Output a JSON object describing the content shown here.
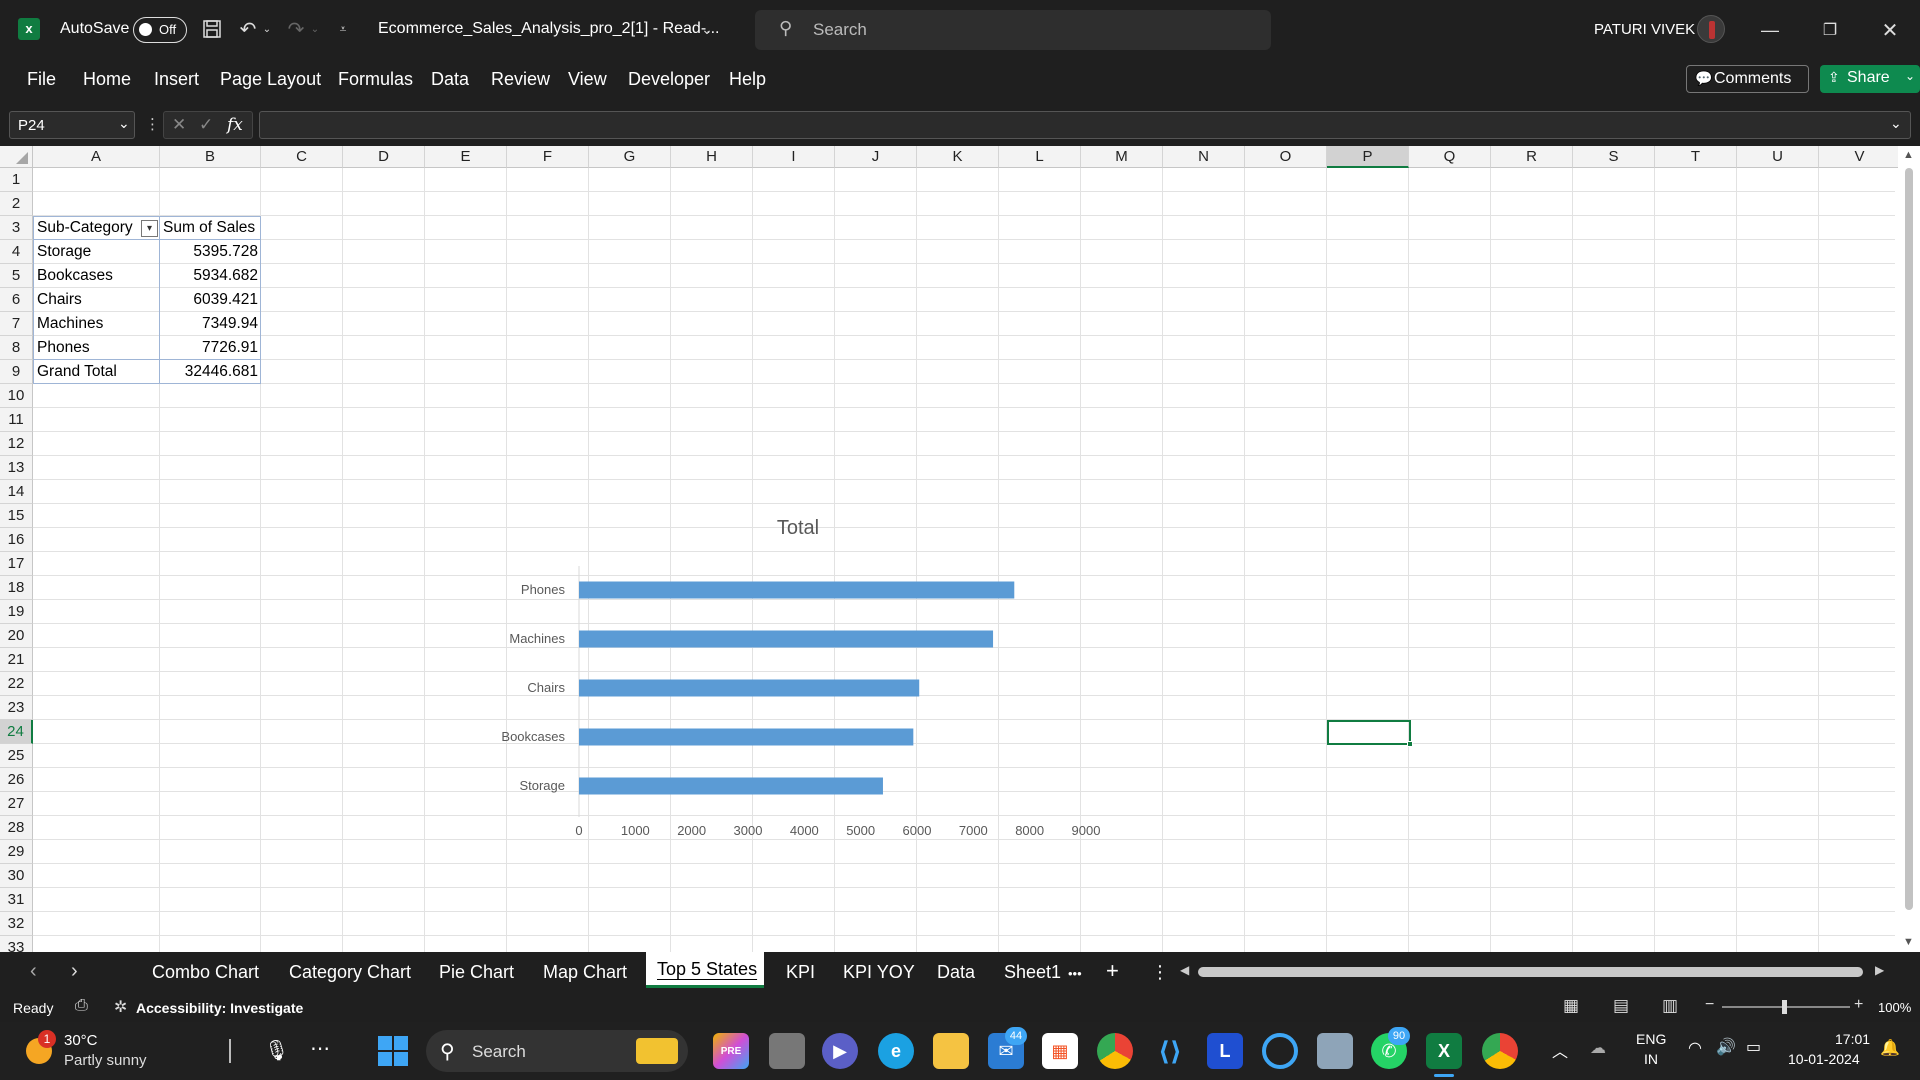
{
  "titlebar": {
    "autosave_label": "AutoSave",
    "autosave_state": "Off",
    "file_title": "Ecommerce_Sales_Analysis_pro_2[1]  -  Read-...",
    "search_placeholder": "Search",
    "user_name": "PATURI VIVEK"
  },
  "ribbon": {
    "tabs": [
      "File",
      "Home",
      "Insert",
      "Page Layout",
      "Formulas",
      "Data",
      "Review",
      "View",
      "Developer",
      "Help"
    ],
    "comments_label": "Comments",
    "share_label": "Share"
  },
  "formula_bar": {
    "name_box": "P24",
    "fx": "fx",
    "formula": ""
  },
  "grid": {
    "columns": [
      "A",
      "B",
      "C",
      "D",
      "E",
      "F",
      "G",
      "H",
      "I",
      "J",
      "K",
      "L",
      "M",
      "N",
      "O",
      "P",
      "Q",
      "R",
      "S",
      "T",
      "U",
      "V"
    ],
    "rows": [
      "1",
      "2",
      "3",
      "4",
      "5",
      "6",
      "7",
      "8",
      "9",
      "10",
      "11",
      "12",
      "13",
      "14",
      "15",
      "16",
      "17",
      "18",
      "19",
      "20",
      "21",
      "22",
      "23",
      "24",
      "25",
      "26",
      "27",
      "28",
      "29",
      "30",
      "31",
      "32",
      "33"
    ],
    "selected_cell": "P24"
  },
  "pivot": {
    "header_a": "Sub-Category",
    "header_b": "Sum of Sales",
    "rows": [
      {
        "label": "Storage",
        "value": "5395.728"
      },
      {
        "label": "Bookcases",
        "value": "5934.682"
      },
      {
        "label": "Chairs",
        "value": "6039.421"
      },
      {
        "label": "Machines",
        "value": "7349.94"
      },
      {
        "label": "Phones",
        "value": "7726.91"
      }
    ],
    "total_label": "Grand Total",
    "total_value": "32446.681"
  },
  "chart_data": {
    "type": "bar",
    "orientation": "horizontal",
    "title": "Total",
    "categories": [
      "Phones",
      "Machines",
      "Chairs",
      "Bookcases",
      "Storage"
    ],
    "values": [
      7726.91,
      7349.94,
      6039.421,
      5934.682,
      5395.728
    ],
    "xlim": [
      0,
      9000
    ],
    "xticks": [
      "0",
      "1000",
      "2000",
      "3000",
      "4000",
      "5000",
      "6000",
      "7000",
      "8000",
      "9000"
    ],
    "bar_color": "#5b9bd5",
    "grid": false,
    "legend": "none"
  },
  "sheet_tabs": {
    "tabs": [
      "Combo Chart",
      "Category Chart",
      "Pie Chart",
      "Map Chart",
      "Top 5 States",
      "KPI",
      "KPI YOY",
      "Data",
      "Sheet1"
    ],
    "active": "Top 5 States",
    "more": "•••",
    "add": "+"
  },
  "statusbar": {
    "ready": "Ready",
    "accessibility": "Accessibility: Investigate",
    "zoom": "100%"
  },
  "taskbar": {
    "weather_temp": "30°C",
    "weather_desc": "Partly sunny",
    "weather_badge": "1",
    "search_label": "Search",
    "mail_badge": "44",
    "whatsapp_badge": "90",
    "lang_line1": "ENG",
    "lang_line2": "IN",
    "time": "17:01",
    "date": "10-01-2024"
  }
}
